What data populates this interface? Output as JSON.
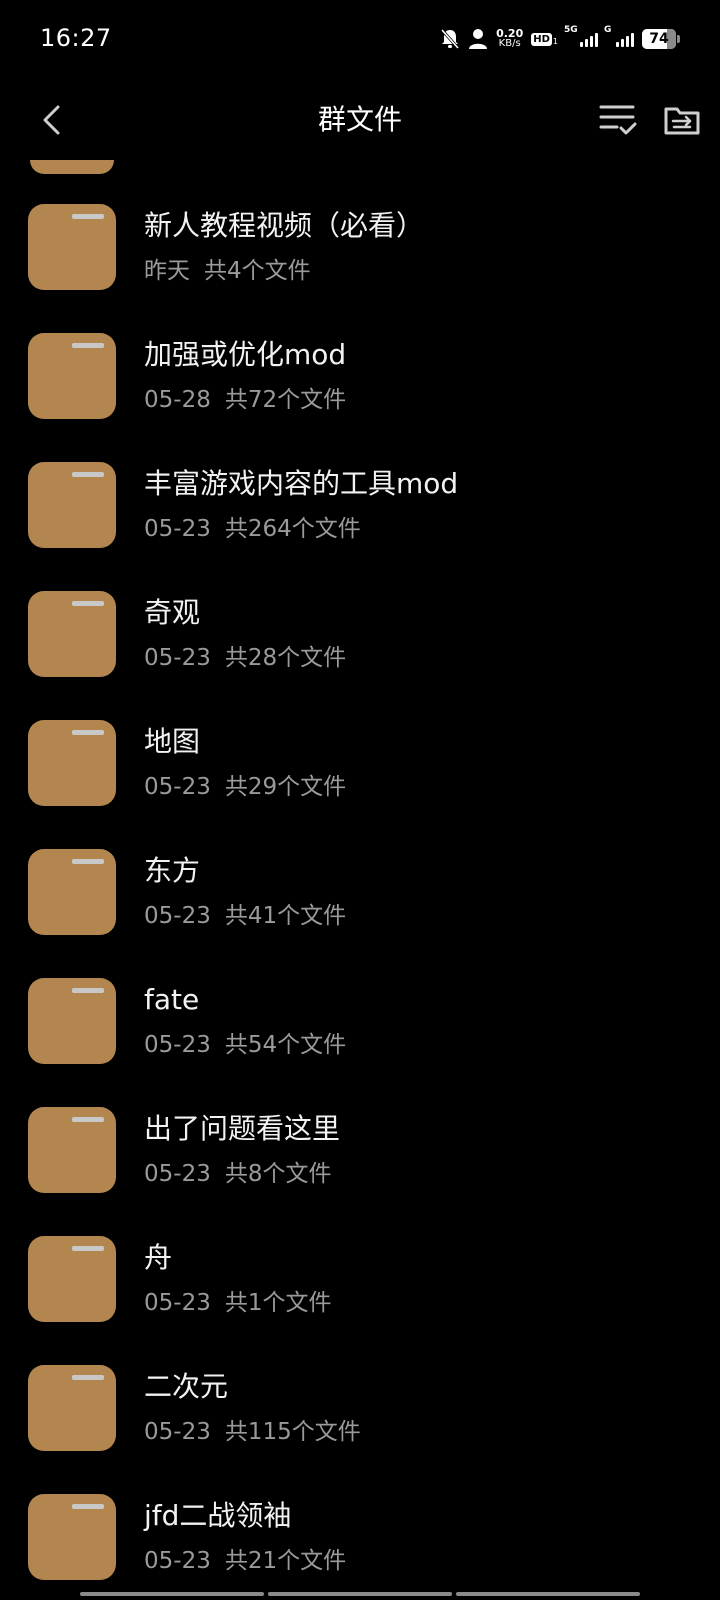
{
  "status_bar": {
    "time": "16:27",
    "net_speed_value": "0.20",
    "net_speed_unit": "KB/s",
    "hd_label": "HD",
    "hd_sub": "1",
    "sim1_label": "5G",
    "sim2_label": "G",
    "battery_percent": "74",
    "battery_level": 0.74
  },
  "header": {
    "title": "群文件",
    "back_icon": "chevron-left-icon",
    "sort_icon": "sort-check-icon",
    "move_icon": "folder-move-icon"
  },
  "folders": [
    {
      "name": "新人教程视频（必看）",
      "date": "昨天",
      "count": "共4个文件"
    },
    {
      "name": "加强或优化mod",
      "date": "05-28",
      "count": "共72个文件"
    },
    {
      "name": "丰富游戏内容的工具mod",
      "date": "05-23",
      "count": "共264个文件"
    },
    {
      "name": "奇观",
      "date": "05-23",
      "count": "共28个文件"
    },
    {
      "name": "地图",
      "date": "05-23",
      "count": "共29个文件"
    },
    {
      "name": "东方",
      "date": "05-23",
      "count": "共41个文件"
    },
    {
      "name": "fate",
      "date": "05-23",
      "count": "共54个文件"
    },
    {
      "name": "出了问题看这里",
      "date": "05-23",
      "count": "共8个文件"
    },
    {
      "name": "舟",
      "date": "05-23",
      "count": "共1个文件"
    },
    {
      "name": "二次元",
      "date": "05-23",
      "count": "共115个文件"
    },
    {
      "name": "jfd二战领袖",
      "date": "05-23",
      "count": "共21个文件"
    }
  ],
  "colors": {
    "background": "#000000",
    "folder": "#b38650",
    "secondary_text": "#9a9a9a"
  }
}
